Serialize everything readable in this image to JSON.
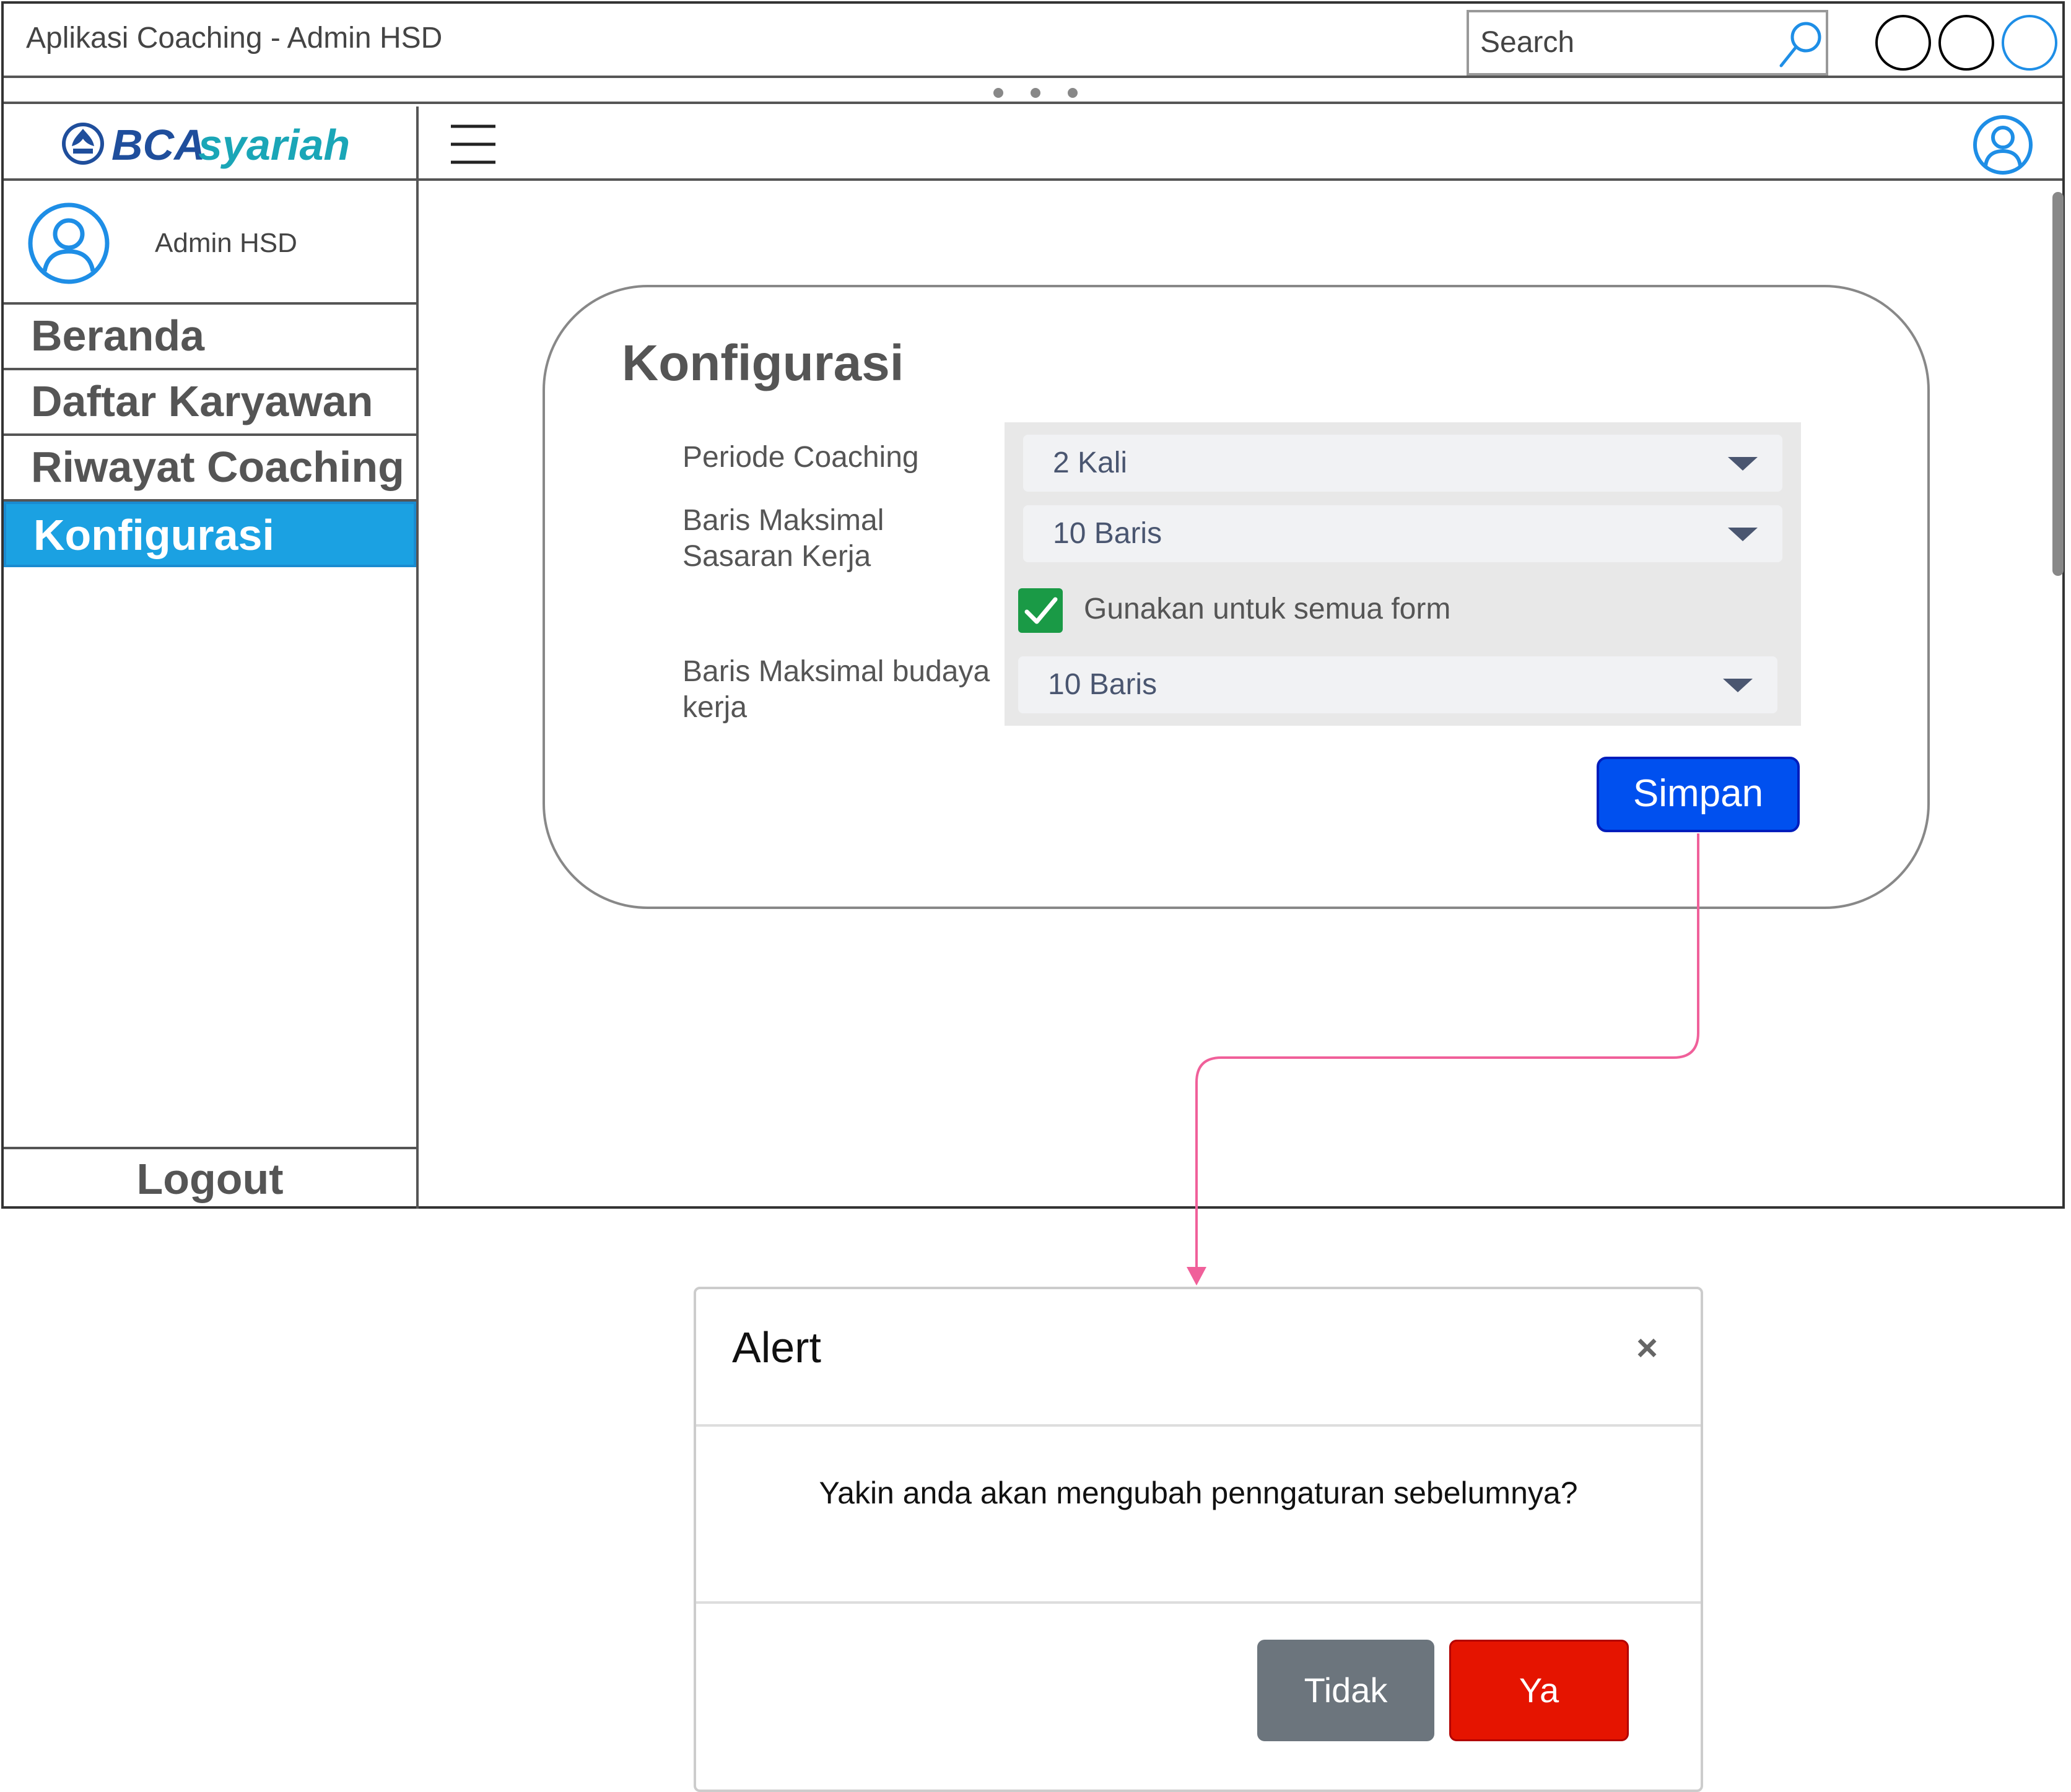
{
  "window": {
    "title": "Aplikasi Coaching - Admin HSD",
    "search_placeholder": "Search"
  },
  "brand": {
    "logo_text_1": "BCA",
    "logo_text_2": "syariah",
    "primary_color": "#1ba1e2"
  },
  "sidebar": {
    "profile_name": "Admin HSD",
    "items": [
      {
        "label": "Beranda",
        "active": false
      },
      {
        "label": "Daftar Karyawan",
        "active": false
      },
      {
        "label": "Riwayat Coaching",
        "active": false
      },
      {
        "label": "Konfigurasi",
        "active": true
      }
    ],
    "logout_label": "Logout"
  },
  "config": {
    "title": "Konfigurasi",
    "fields": {
      "periode": {
        "label": "Periode Coaching",
        "value": "2 Kali"
      },
      "sasaran": {
        "label_line1": "Baris Maksimal",
        "label_line2": "Sasaran Kerja",
        "value": "10 Baris"
      },
      "checkbox": {
        "label": "Gunakan untuk semua form",
        "checked": true
      },
      "budaya": {
        "label_line1": "Baris Maksimal budaya",
        "label_line2": "kerja",
        "value": "10 Baris"
      }
    },
    "save_label": "Simpan",
    "save_color": "#0050ef"
  },
  "modal": {
    "title": "Alert",
    "close_glyph": "×",
    "message": "Yakin anda akan mengubah penngaturan sebelumnya?",
    "cancel_label": "Tidak",
    "confirm_label": "Ya",
    "cancel_color": "#6c757d",
    "confirm_color": "#e51400"
  },
  "connector_color": "#f0609a"
}
